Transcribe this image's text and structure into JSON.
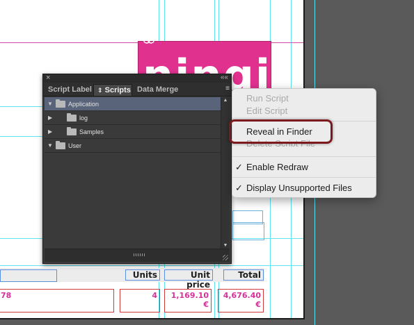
{
  "document": {
    "brand_text": "ningi",
    "table": {
      "headers": [
        "Units",
        "Unit price",
        "Total"
      ],
      "cells": [
        "78",
        "4",
        "1,169.10 €",
        "4,676.40 €"
      ]
    },
    "accent_color": "#e0318f"
  },
  "panel": {
    "close_icon": "×",
    "collapse_icon": "««",
    "menu_icon": "≡",
    "tabs": [
      {
        "label": "Script Label",
        "active": false
      },
      {
        "label": "Scripts",
        "active": true
      },
      {
        "label": "Data Merge",
        "active": false
      }
    ],
    "tree": [
      {
        "label": "Application",
        "expanded": true,
        "level": 0,
        "selected": true
      },
      {
        "label": "log",
        "expanded": false,
        "level": 1,
        "selected": false
      },
      {
        "label": "Samples",
        "expanded": false,
        "level": 1,
        "selected": false
      },
      {
        "label": "User",
        "expanded": true,
        "level": 0,
        "selected": false
      }
    ]
  },
  "menu": {
    "items": [
      {
        "label": "Run Script",
        "enabled": false,
        "checked": false
      },
      {
        "label": "Edit Script",
        "enabled": false,
        "checked": false
      },
      {
        "label": "Reveal in Finder",
        "enabled": true,
        "checked": false
      },
      {
        "label": "Delete Script File",
        "enabled": false,
        "checked": false
      },
      {
        "label": "Enable Redraw",
        "enabled": true,
        "checked": true
      },
      {
        "label": "Display Unsupported Files",
        "enabled": true,
        "checked": true
      }
    ],
    "check_glyph": "✓",
    "highlight_color": "#7b1b1f"
  }
}
